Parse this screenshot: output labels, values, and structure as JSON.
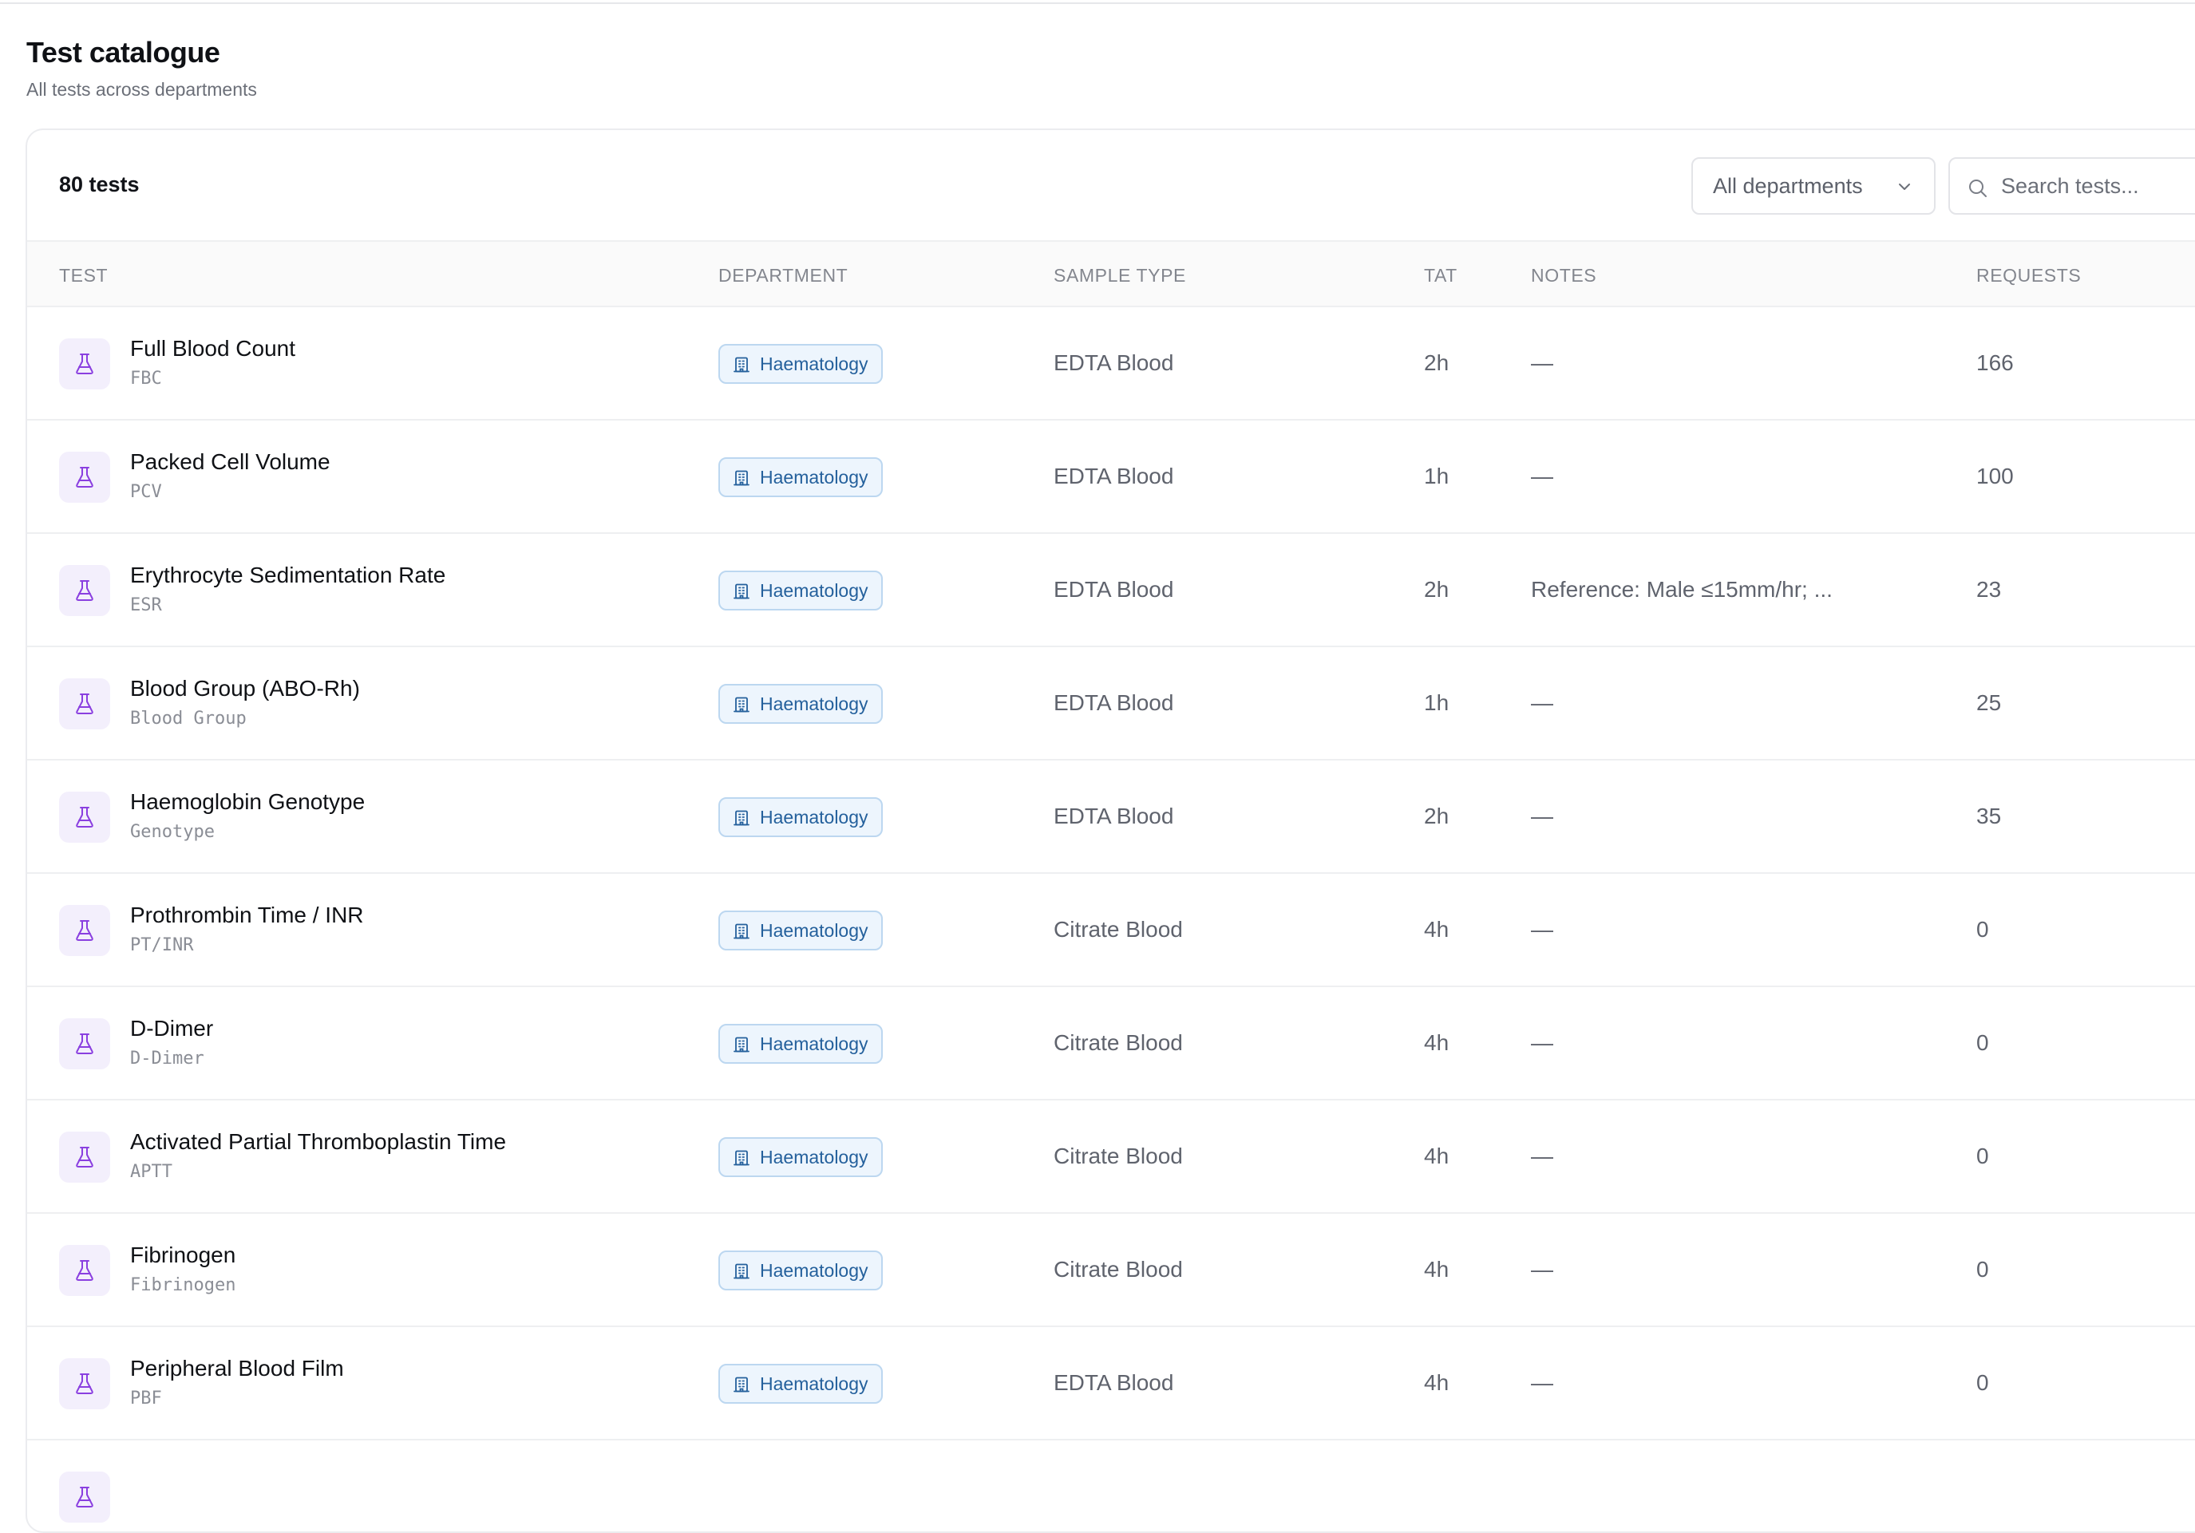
{
  "page": {
    "title": "Test catalogue",
    "subtitle": "All tests across departments"
  },
  "toolbar": {
    "count_label": "80 tests",
    "department_filter": "All departments",
    "search_placeholder": "Search tests..."
  },
  "table": {
    "columns": {
      "test": "TEST",
      "department": "DEPARTMENT",
      "sample_type": "SAMPLE TYPE",
      "tat": "TAT",
      "notes": "NOTES",
      "requests": "REQUESTS"
    },
    "rows": [
      {
        "name": "Full Blood Count",
        "code": "FBC",
        "department": "Haematology",
        "sample_type": "EDTA Blood",
        "tat": "2h",
        "notes": "—",
        "requests": "166"
      },
      {
        "name": "Packed Cell Volume",
        "code": "PCV",
        "department": "Haematology",
        "sample_type": "EDTA Blood",
        "tat": "1h",
        "notes": "—",
        "requests": "100"
      },
      {
        "name": "Erythrocyte Sedimentation Rate",
        "code": "ESR",
        "department": "Haematology",
        "sample_type": "EDTA Blood",
        "tat": "2h",
        "notes": "Reference: Male ≤15mm/hr; ...",
        "requests": "23"
      },
      {
        "name": "Blood Group (ABO-Rh)",
        "code": "Blood Group",
        "department": "Haematology",
        "sample_type": "EDTA Blood",
        "tat": "1h",
        "notes": "—",
        "requests": "25"
      },
      {
        "name": "Haemoglobin Genotype",
        "code": "Genotype",
        "department": "Haematology",
        "sample_type": "EDTA Blood",
        "tat": "2h",
        "notes": "—",
        "requests": "35"
      },
      {
        "name": "Prothrombin Time / INR",
        "code": "PT/INR",
        "department": "Haematology",
        "sample_type": "Citrate Blood",
        "tat": "4h",
        "notes": "—",
        "requests": "0"
      },
      {
        "name": "D-Dimer",
        "code": "D-Dimer",
        "department": "Haematology",
        "sample_type": "Citrate Blood",
        "tat": "4h",
        "notes": "—",
        "requests": "0"
      },
      {
        "name": "Activated Partial Thromboplastin Time",
        "code": "APTT",
        "department": "Haematology",
        "sample_type": "Citrate Blood",
        "tat": "4h",
        "notes": "—",
        "requests": "0"
      },
      {
        "name": "Fibrinogen",
        "code": "Fibrinogen",
        "department": "Haematology",
        "sample_type": "Citrate Blood",
        "tat": "4h",
        "notes": "—",
        "requests": "0"
      },
      {
        "name": "Peripheral Blood Film",
        "code": "PBF",
        "department": "Haematology",
        "sample_type": "EDTA Blood",
        "tat": "4h",
        "notes": "—",
        "requests": "0"
      }
    ]
  },
  "icons": {
    "row_icon": "flask-icon",
    "department_icon": "building-icon",
    "filter_icon": "chevron-down-icon",
    "search_icon": "search-icon"
  },
  "colors": {
    "flask_bg": "#f3effc",
    "flask_stroke": "#8a3fe0",
    "badge_bg": "#edf5fd",
    "badge_border": "#bcd7f0",
    "badge_text": "#24609c"
  }
}
